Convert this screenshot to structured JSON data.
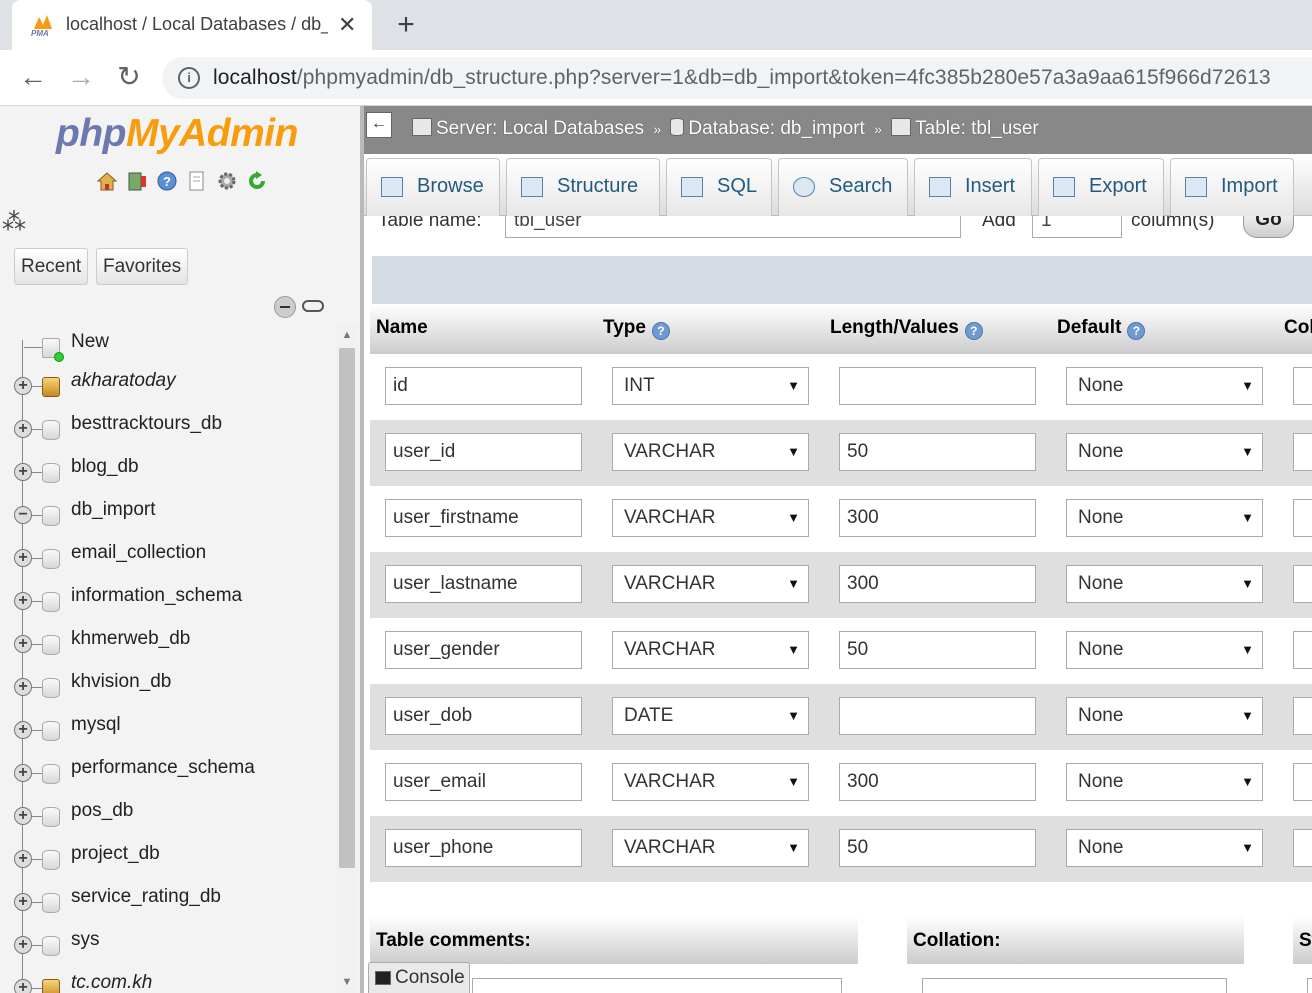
{
  "browser": {
    "tab_title": "localhost / Local Databases / db_import / tbl_user",
    "favicon_text": "PMA",
    "new_tab_label": "+",
    "close_label": "✕",
    "url_host": "localhost",
    "url_path": "/phpmyadmin/db_structure.php?server=1&db=db_import&token=4fc385b280e57a3a9aa615f966d72613",
    "back_label": "←",
    "forward_label": "→",
    "reload_label": "↻",
    "info_label": "i"
  },
  "nav": {
    "logo_php": "php",
    "logo_myadmin": "MyAdmin",
    "recent_label": "Recent",
    "favorites_label": "Favorites",
    "new_label": "New",
    "databases": [
      {
        "name": "akharatoday",
        "italic": true
      },
      {
        "name": "besttracktours_db"
      },
      {
        "name": "blog_db"
      },
      {
        "name": "db_import",
        "expanded": true
      },
      {
        "name": "email_collection"
      },
      {
        "name": "information_schema"
      },
      {
        "name": "khmerweb_db"
      },
      {
        "name": "khvision_db"
      },
      {
        "name": "mysql"
      },
      {
        "name": "performance_schema"
      },
      {
        "name": "pos_db"
      },
      {
        "name": "project_db"
      },
      {
        "name": "service_rating_db"
      },
      {
        "name": "sys"
      },
      {
        "name": "tc.com.kh",
        "italic": true
      }
    ]
  },
  "breadcrumb": {
    "server": "Server: Local Databases",
    "database": "Database: db_import",
    "table": "Table: tbl_user",
    "sep": "»"
  },
  "tabs": [
    {
      "label": "Browse"
    },
    {
      "label": "Structure"
    },
    {
      "label": "SQL"
    },
    {
      "label": "Search"
    },
    {
      "label": "Insert"
    },
    {
      "label": "Export"
    },
    {
      "label": "Import"
    }
  ],
  "table_form": {
    "table_name_label": "Table name:",
    "table_name_value": "tbl_user",
    "add_label": "Add",
    "add_value": "1",
    "columns_label": "column(s)",
    "go_label": "Go"
  },
  "columns_header": {
    "name": "Name",
    "type": "Type",
    "length": "Length/Values",
    "default": "Default",
    "collation": "Collation"
  },
  "fields": [
    {
      "name": "id",
      "type": "INT",
      "length": "",
      "default": "None"
    },
    {
      "name": "user_id",
      "type": "VARCHAR",
      "length": "50",
      "default": "None"
    },
    {
      "name": "user_firstname",
      "type": "VARCHAR",
      "length": "300",
      "default": "None"
    },
    {
      "name": "user_lastname",
      "type": "VARCHAR",
      "length": "300",
      "default": "None"
    },
    {
      "name": "user_gender",
      "type": "VARCHAR",
      "length": "50",
      "default": "None"
    },
    {
      "name": "user_dob",
      "type": "DATE",
      "length": "",
      "default": "None"
    },
    {
      "name": "user_email",
      "type": "VARCHAR",
      "length": "300",
      "default": "None"
    },
    {
      "name": "user_phone",
      "type": "VARCHAR",
      "length": "50",
      "default": "None"
    }
  ],
  "bottom": {
    "table_comments_label": "Table comments:",
    "collation_label": "Collation:",
    "storage_label": "Storage Engine:"
  },
  "console_label": "Console",
  "colors": {
    "tab_text": "#235a81",
    "topbar": "#888888",
    "logo_php": "#6c78af",
    "logo_myadmin": "#f89c0e"
  }
}
